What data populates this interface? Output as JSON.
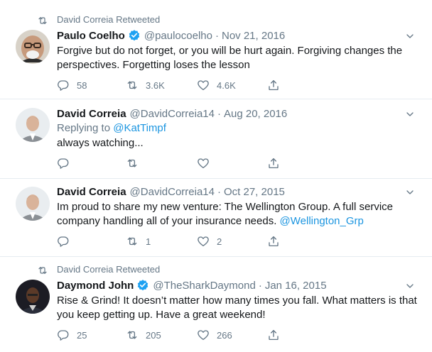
{
  "tweets": [
    {
      "retweeted_by": "David Correia Retweeted",
      "name": "Paulo Coelho",
      "verified": true,
      "handle": "@paulocoelho",
      "separator": "·",
      "date": "Nov 21, 2016",
      "text": "Forgive but do not forget, or you will be hurt again. Forgiving changes the perspectives. Forgetting loses the lesson",
      "replies": "58",
      "retweets": "3.6K",
      "likes": "4.6K"
    },
    {
      "name": "David Correia",
      "handle": "@DavidCorreia14",
      "separator": "·",
      "date": "Aug 20, 2016",
      "replying_prefix": "Replying to ",
      "replying_to": "@KatTimpf",
      "text": "always watching..."
    },
    {
      "name": "David Correia",
      "handle": "@DavidCorreia14",
      "separator": "·",
      "date": "Oct 27, 2015",
      "text": "Im proud to share my new venture: The Wellington Group. A full service company handling all of your insurance needs. ",
      "link": "@Wellington_Grp",
      "retweets": "1",
      "likes": "2"
    },
    {
      "retweeted_by": "David Correia Retweeted",
      "name": "Daymond John",
      "verified": true,
      "handle": "@TheSharkDaymond",
      "separator": "·",
      "date": "Jan 16, 2015",
      "text": "Rise & Grind! It doesn’t matter how many times you fall. What matters is that you keep getting up. Have a great weekend!",
      "replies": "25",
      "retweets": "205",
      "likes": "266"
    }
  ],
  "icons": {
    "retweet_indicator": "retweet-icon",
    "verified": "verified-badge-icon",
    "menu": "chevron-down-icon",
    "reply": "reply-icon",
    "retweet": "retweet-icon",
    "like": "heart-icon",
    "share": "share-icon"
  },
  "colors": {
    "accent": "#1da1f2",
    "link": "#1b95e0",
    "secondary_text": "#657786",
    "divider": "#e6ecf0"
  }
}
